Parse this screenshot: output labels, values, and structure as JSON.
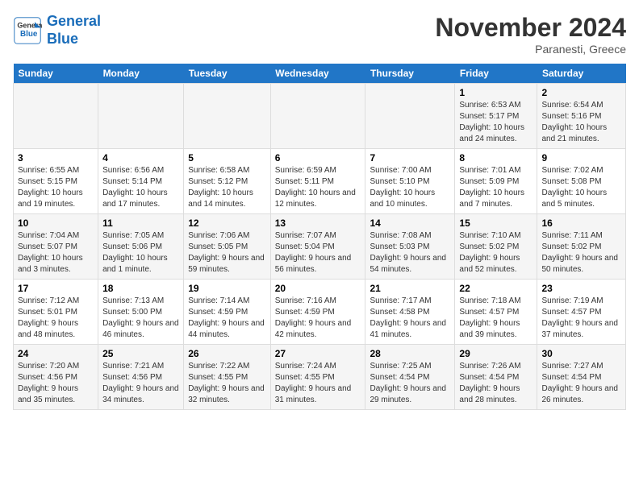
{
  "header": {
    "logo_line1": "General",
    "logo_line2": "Blue",
    "month": "November 2024",
    "location": "Paranesti, Greece"
  },
  "weekdays": [
    "Sunday",
    "Monday",
    "Tuesday",
    "Wednesday",
    "Thursday",
    "Friday",
    "Saturday"
  ],
  "weeks": [
    [
      {
        "day": "",
        "info": ""
      },
      {
        "day": "",
        "info": ""
      },
      {
        "day": "",
        "info": ""
      },
      {
        "day": "",
        "info": ""
      },
      {
        "day": "",
        "info": ""
      },
      {
        "day": "1",
        "info": "Sunrise: 6:53 AM\nSunset: 5:17 PM\nDaylight: 10 hours and 24 minutes."
      },
      {
        "day": "2",
        "info": "Sunrise: 6:54 AM\nSunset: 5:16 PM\nDaylight: 10 hours and 21 minutes."
      }
    ],
    [
      {
        "day": "3",
        "info": "Sunrise: 6:55 AM\nSunset: 5:15 PM\nDaylight: 10 hours and 19 minutes."
      },
      {
        "day": "4",
        "info": "Sunrise: 6:56 AM\nSunset: 5:14 PM\nDaylight: 10 hours and 17 minutes."
      },
      {
        "day": "5",
        "info": "Sunrise: 6:58 AM\nSunset: 5:12 PM\nDaylight: 10 hours and 14 minutes."
      },
      {
        "day": "6",
        "info": "Sunrise: 6:59 AM\nSunset: 5:11 PM\nDaylight: 10 hours and 12 minutes."
      },
      {
        "day": "7",
        "info": "Sunrise: 7:00 AM\nSunset: 5:10 PM\nDaylight: 10 hours and 10 minutes."
      },
      {
        "day": "8",
        "info": "Sunrise: 7:01 AM\nSunset: 5:09 PM\nDaylight: 10 hours and 7 minutes."
      },
      {
        "day": "9",
        "info": "Sunrise: 7:02 AM\nSunset: 5:08 PM\nDaylight: 10 hours and 5 minutes."
      }
    ],
    [
      {
        "day": "10",
        "info": "Sunrise: 7:04 AM\nSunset: 5:07 PM\nDaylight: 10 hours and 3 minutes."
      },
      {
        "day": "11",
        "info": "Sunrise: 7:05 AM\nSunset: 5:06 PM\nDaylight: 10 hours and 1 minute."
      },
      {
        "day": "12",
        "info": "Sunrise: 7:06 AM\nSunset: 5:05 PM\nDaylight: 9 hours and 59 minutes."
      },
      {
        "day": "13",
        "info": "Sunrise: 7:07 AM\nSunset: 5:04 PM\nDaylight: 9 hours and 56 minutes."
      },
      {
        "day": "14",
        "info": "Sunrise: 7:08 AM\nSunset: 5:03 PM\nDaylight: 9 hours and 54 minutes."
      },
      {
        "day": "15",
        "info": "Sunrise: 7:10 AM\nSunset: 5:02 PM\nDaylight: 9 hours and 52 minutes."
      },
      {
        "day": "16",
        "info": "Sunrise: 7:11 AM\nSunset: 5:02 PM\nDaylight: 9 hours and 50 minutes."
      }
    ],
    [
      {
        "day": "17",
        "info": "Sunrise: 7:12 AM\nSunset: 5:01 PM\nDaylight: 9 hours and 48 minutes."
      },
      {
        "day": "18",
        "info": "Sunrise: 7:13 AM\nSunset: 5:00 PM\nDaylight: 9 hours and 46 minutes."
      },
      {
        "day": "19",
        "info": "Sunrise: 7:14 AM\nSunset: 4:59 PM\nDaylight: 9 hours and 44 minutes."
      },
      {
        "day": "20",
        "info": "Sunrise: 7:16 AM\nSunset: 4:59 PM\nDaylight: 9 hours and 42 minutes."
      },
      {
        "day": "21",
        "info": "Sunrise: 7:17 AM\nSunset: 4:58 PM\nDaylight: 9 hours and 41 minutes."
      },
      {
        "day": "22",
        "info": "Sunrise: 7:18 AM\nSunset: 4:57 PM\nDaylight: 9 hours and 39 minutes."
      },
      {
        "day": "23",
        "info": "Sunrise: 7:19 AM\nSunset: 4:57 PM\nDaylight: 9 hours and 37 minutes."
      }
    ],
    [
      {
        "day": "24",
        "info": "Sunrise: 7:20 AM\nSunset: 4:56 PM\nDaylight: 9 hours and 35 minutes."
      },
      {
        "day": "25",
        "info": "Sunrise: 7:21 AM\nSunset: 4:56 PM\nDaylight: 9 hours and 34 minutes."
      },
      {
        "day": "26",
        "info": "Sunrise: 7:22 AM\nSunset: 4:55 PM\nDaylight: 9 hours and 32 minutes."
      },
      {
        "day": "27",
        "info": "Sunrise: 7:24 AM\nSunset: 4:55 PM\nDaylight: 9 hours and 31 minutes."
      },
      {
        "day": "28",
        "info": "Sunrise: 7:25 AM\nSunset: 4:54 PM\nDaylight: 9 hours and 29 minutes."
      },
      {
        "day": "29",
        "info": "Sunrise: 7:26 AM\nSunset: 4:54 PM\nDaylight: 9 hours and 28 minutes."
      },
      {
        "day": "30",
        "info": "Sunrise: 7:27 AM\nSunset: 4:54 PM\nDaylight: 9 hours and 26 minutes."
      }
    ]
  ]
}
